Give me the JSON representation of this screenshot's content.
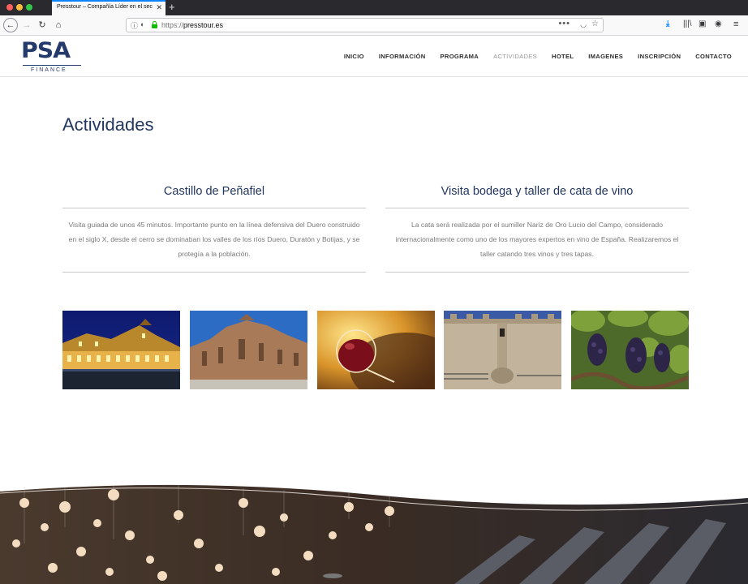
{
  "browser": {
    "tab_title": "Presstour – Compañía Líder en el sec",
    "tab_close": "✕",
    "new_tab": "+",
    "url_scheme": "https://",
    "url_host": "presstour.es",
    "icons": [
      "back-icon",
      "forward-icon",
      "reload-icon",
      "home-icon",
      "info-icon",
      "permissions-icon",
      "lock-icon",
      "page-actions-icon",
      "pocket-icon",
      "bookmark-star-icon",
      "download-icon",
      "library-icon",
      "sidebar-icon",
      "account-icon",
      "menu-icon"
    ]
  },
  "logo": {
    "brand": "PSA",
    "sub": "FINANCE",
    "color": "#243a6b"
  },
  "nav": {
    "items": [
      {
        "label": "INICIO",
        "active": false
      },
      {
        "label": "INFORMACIÓN",
        "active": false
      },
      {
        "label": "PROGRAMA",
        "active": false
      },
      {
        "label": "ACTIVIDADES",
        "active": true
      },
      {
        "label": "HOTEL",
        "active": false
      },
      {
        "label": "IMAGENES",
        "active": false
      },
      {
        "label": "INSCRIPCIÓN",
        "active": false
      },
      {
        "label": "CONTACTO",
        "active": false
      }
    ]
  },
  "page": {
    "title": "Actividades",
    "activities": [
      {
        "title": "Castillo de Peñafiel",
        "description": "Visita guiada de unos 45 minutos. Importante punto en la línea defensiva del Duero construido en el siglo X, desde el cerro se dominaban los valles de los ríos Duero, Duratón y Botijas, y se protegía a la población."
      },
      {
        "title": "Visita bodega y taller de cata de vino",
        "description": "La cata será realizada por el sumiller Nariz de Oro Lucio del Campo, considerado internacionalmente como uno de los mayores expertos en vino de España. Realizaremos el taller catando tres vinos y tres tapas."
      }
    ],
    "gallery": [
      "hotel-night-photo",
      "stone-church-photo",
      "wine-glass-photo",
      "castle-tower-photo",
      "grape-vine-photo"
    ]
  },
  "colors": {
    "accent": "#22365e",
    "link_active": "#9a9a9a",
    "firefox_blue": "#0a84ff"
  }
}
